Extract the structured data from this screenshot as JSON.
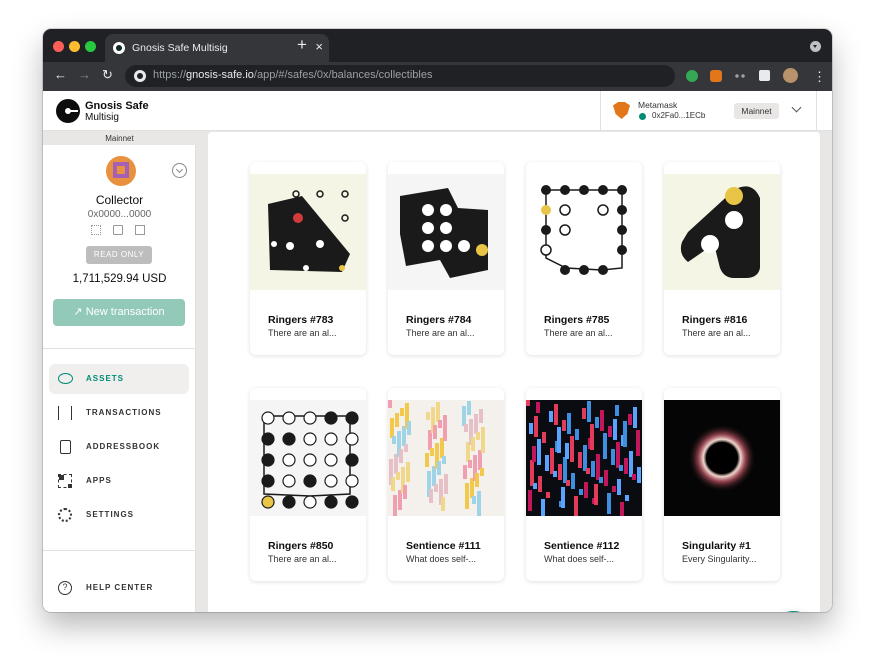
{
  "browser": {
    "tab_title": "Gnosis Safe Multisig",
    "tab_close": "×",
    "new_tab": "+",
    "back": "←",
    "forward": "→",
    "reload": "↻",
    "url_scheme": "https://",
    "url_host": "gnosis-safe.io",
    "url_path": "/app/#/safes/0x/balances/collectibles",
    "menu": "⋮"
  },
  "header": {
    "logo_name": "Gnosis Safe",
    "logo_sub": "Multisig",
    "wallet_provider": "Metamask",
    "wallet_address": "0x2Fa0...1ECb",
    "network": "Mainnet"
  },
  "sidebar": {
    "network_strip": "Mainnet",
    "safe_name": "Collector",
    "safe_address": "0x0000...0000",
    "read_only": "READ ONLY",
    "balance": "1,711,529.94 USD",
    "new_transaction": "↗  New transaction",
    "nav": [
      {
        "label": "ASSETS",
        "active": true
      },
      {
        "label": "TRANSACTIONS"
      },
      {
        "label": "ADDRESSBOOK"
      },
      {
        "label": "APPS"
      },
      {
        "label": "SETTINGS"
      }
    ],
    "help": "HELP CENTER",
    "help_glyph": "?"
  },
  "collectibles": [
    {
      "title": "Ringers #783",
      "desc": "There are an al...",
      "art": "ringers-783"
    },
    {
      "title": "Ringers #784",
      "desc": "There are an al...",
      "art": "ringers-784"
    },
    {
      "title": "Ringers #785",
      "desc": "There are an al...",
      "art": "ringers-785"
    },
    {
      "title": "Ringers #816",
      "desc": "There are an al...",
      "art": "ringers-816"
    },
    {
      "title": "Ringers #850",
      "desc": "There are an al...",
      "art": "ringers-850"
    },
    {
      "title": "Sentience #111",
      "desc": "What does self-...",
      "art": "sentience-111"
    },
    {
      "title": "Sentience #112",
      "desc": "What does self-...",
      "art": "sentience-112"
    },
    {
      "title": "Singularity #1",
      "desc": "Every Singularity...",
      "art": "singularity-1"
    }
  ],
  "colors": {
    "accent": "#008c73",
    "button": "#92c9b9",
    "ringer_yellow": "#e8c547"
  }
}
